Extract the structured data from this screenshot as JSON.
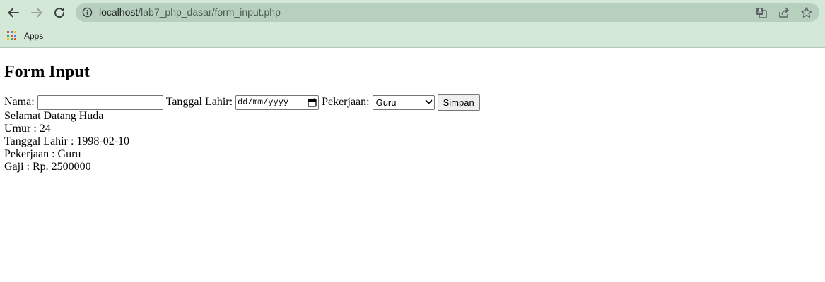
{
  "browser": {
    "url_host": "localhost",
    "url_path": "/lab7_php_dasar/form_input.php",
    "bookmarks": {
      "apps_label": "Apps"
    }
  },
  "page": {
    "title": "Form Input",
    "form": {
      "nama_label": "Nama:",
      "nama_value": "",
      "tanggal_label": "Tanggal Lahir:",
      "tanggal_placeholder": "dd/mm/yyyy",
      "pekerjaan_label": "Pekerjaan:",
      "pekerjaan_selected": "Guru",
      "submit_label": "Simpan"
    },
    "output": {
      "greeting": "Selamat Datang Huda",
      "umur": "Umur : 24",
      "tanggal_lahir": "Tanggal Lahir : 1998-02-10",
      "pekerjaan": "Pekerjaan : Guru",
      "gaji": "Gaji : Rp. 2500000"
    }
  },
  "colors": {
    "chrome_bg": "#d3e8d6",
    "omnibox_bg": "#b7cfbd"
  }
}
